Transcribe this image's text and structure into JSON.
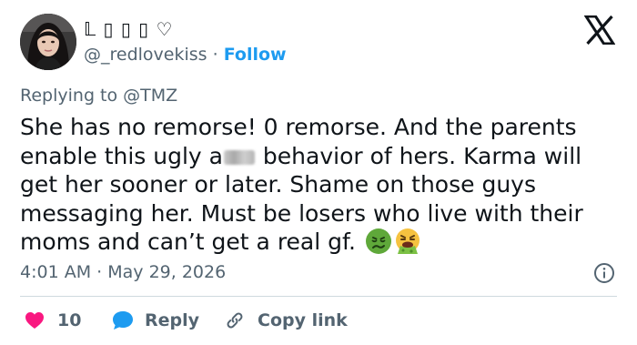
{
  "user": {
    "display_name": "𝕃 ▯ ▯ ▯ ♡",
    "handle": "@_redlovekiss",
    "separator": "·",
    "follow_label": "Follow"
  },
  "reply_context": {
    "prefix": "Replying to",
    "mention": "@TMZ"
  },
  "tweet": {
    "text_part1": "She has no remorse! 0 remorse. And the parents enable this ugly a",
    "text_part2": " behavior of hers. Karma will get her sooner or later. Shame on those guys messaging her. Must be losers who live with their moms and can’t get a real gf. ",
    "emojis": [
      "nauseated-face-icon",
      "vomiting-face-icon"
    ]
  },
  "meta": {
    "time": "4:01 AM",
    "separator": "·",
    "date": "May 29, 2026"
  },
  "actions": {
    "like_count": "10",
    "reply_label": "Reply",
    "copy_link_label": "Copy link"
  },
  "colors": {
    "accent": "#1d9bf0",
    "like": "#f91880",
    "secondary_text": "#536471",
    "divider": "#cfd9de"
  }
}
